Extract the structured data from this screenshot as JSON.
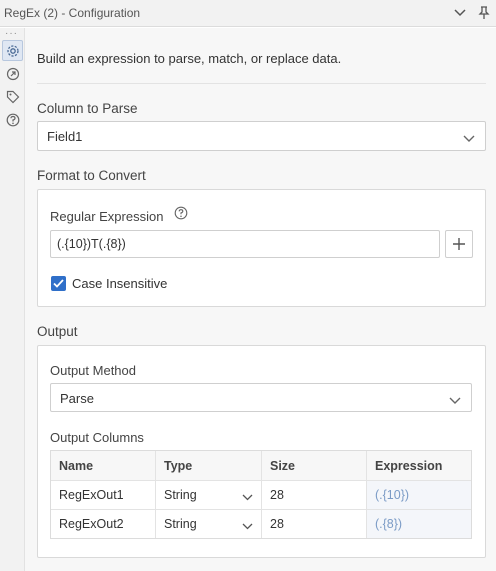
{
  "window": {
    "title": "RegEx (2) - Configuration"
  },
  "rail": {
    "dots": "···"
  },
  "description": "Build an expression to parse, match, or replace data.",
  "column_to_parse": {
    "label": "Column to Parse",
    "value": "Field1"
  },
  "format_to_convert": {
    "label": "Format to Convert",
    "regular_expression": {
      "label": "Regular Expression",
      "value": "(.{10})T(.{8})"
    },
    "case_insensitive": {
      "label": "Case Insensitive",
      "checked": true
    }
  },
  "output": {
    "label": "Output",
    "output_method": {
      "label": "Output Method",
      "value": "Parse"
    },
    "output_columns": {
      "label": "Output Columns",
      "headers": [
        "Name",
        "Type",
        "Size",
        "Expression"
      ],
      "rows": [
        {
          "name": "RegExOut1",
          "type": "String",
          "size": "28",
          "expression": "(.{10})"
        },
        {
          "name": "RegExOut2",
          "type": "String",
          "size": "28",
          "expression": "(.{8})"
        }
      ]
    }
  },
  "colors": {
    "accent": "#2f6fc9",
    "expression_text": "#7b9bc6"
  }
}
